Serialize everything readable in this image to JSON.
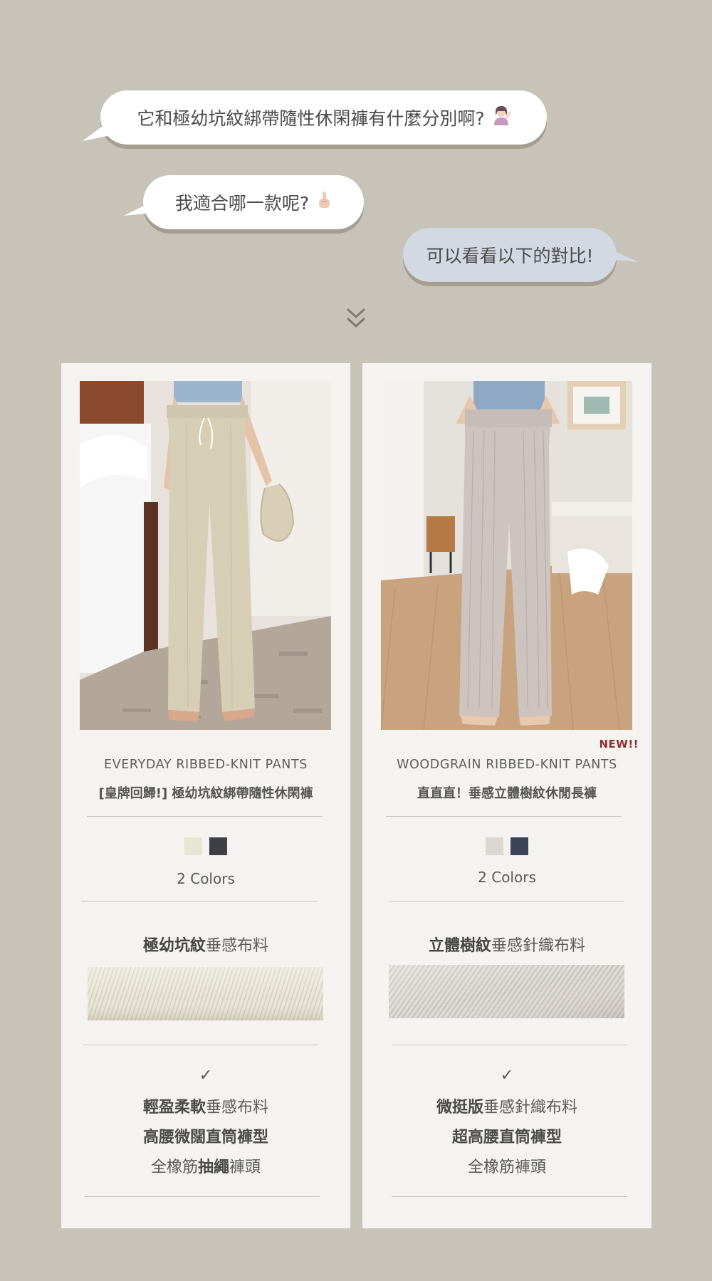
{
  "chat": {
    "question1": "它和極幼坑紋綁帶隨性休閑褲有什麼分別啊?",
    "question2": "我適合哪一款呢?",
    "answer": "可以看看以下的對比!",
    "emoji1": "woman-shrugging-emoji",
    "emoji2": "pointing-up-emoji"
  },
  "products": [
    {
      "name_en": "EVERYDAY RIBBED-KNIT PANTS",
      "name_zh": "[皇牌回歸!] 極幼坑紋綁帶隨性休閑褲",
      "badge": "",
      "swatch_colors": [
        "#e8e4d6",
        "#3e4046"
      ],
      "colors_label": "2 Colors",
      "fabric_bold": "極幼坑紋",
      "fabric_rest": "垂感布料",
      "check": "✓",
      "features": [
        {
          "bold": "輕盈柔軟",
          "rest": "垂感布料",
          "pre": ""
        },
        {
          "bold": "高腰微闊直筒褲型",
          "rest": "",
          "pre": ""
        },
        {
          "pre": "全橡筋",
          "bold": "抽繩",
          "rest": "褲頭"
        }
      ]
    },
    {
      "name_en": "WOODGRAIN RIBBED-KNIT PANTS",
      "name_zh": "直直直！垂感立體樹紋休閒長褲",
      "badge": "NEW!!",
      "swatch_colors": [
        "#ddd7d2",
        "#3c4258"
      ],
      "colors_label": "2 Colors",
      "fabric_bold": "立體樹紋",
      "fabric_rest": "垂感針織布料",
      "check": "✓",
      "features": [
        {
          "bold": "微挺版",
          "rest": "垂感針織布料",
          "pre": ""
        },
        {
          "bold": "超高腰直筒褲型",
          "rest": "",
          "pre": ""
        },
        {
          "pre": "全橡筋褲頭",
          "bold": "",
          "rest": ""
        }
      ]
    }
  ],
  "colors": {
    "background": "#c8c3b9",
    "card": "#f4f3f0",
    "answer_bubble": "#d3d9e2",
    "new_badge": "#8e2f2f"
  }
}
